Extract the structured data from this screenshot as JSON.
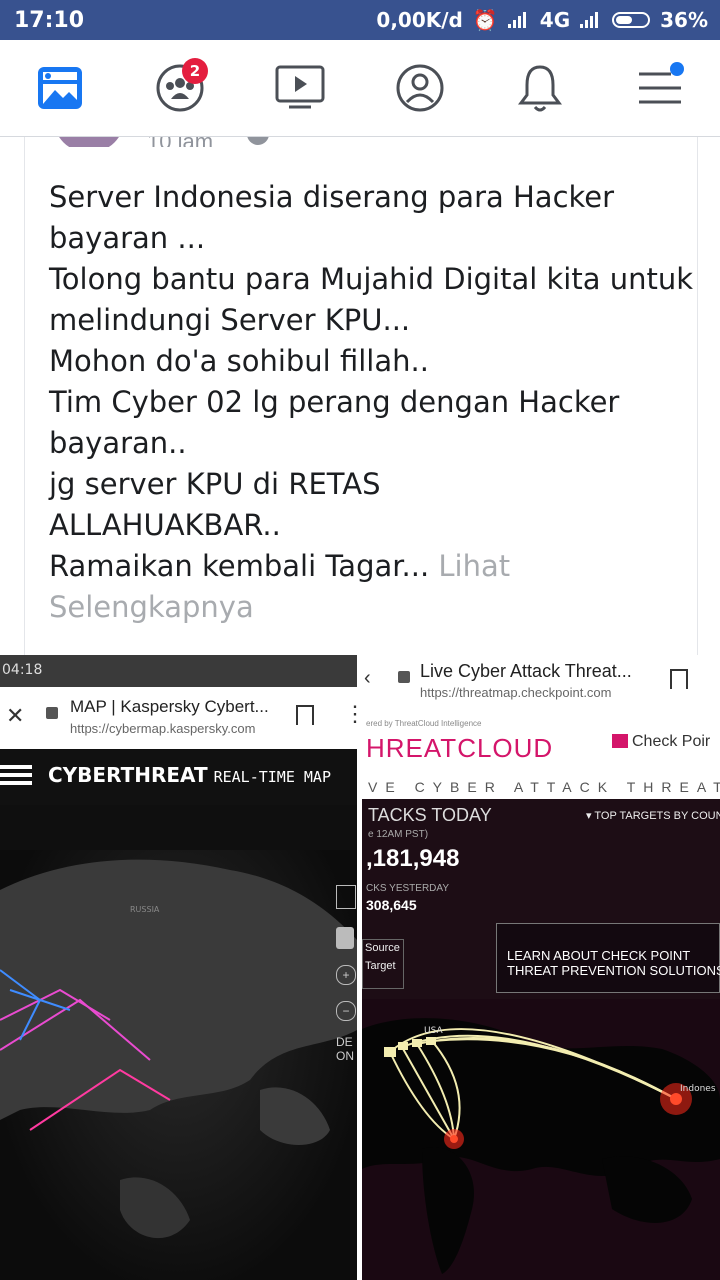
{
  "status_bar": {
    "time": "17:10",
    "network_speed": "0,00K/d",
    "network_type": "4G",
    "battery": "36%"
  },
  "nav": {
    "items": [
      {
        "name": "news-feed",
        "icon": "news-feed-icon"
      },
      {
        "name": "groups",
        "icon": "groups-icon",
        "badge": "2"
      },
      {
        "name": "watch",
        "icon": "video-icon"
      },
      {
        "name": "profile",
        "icon": "profile-icon"
      },
      {
        "name": "notifications",
        "icon": "bell-icon"
      },
      {
        "name": "menu",
        "icon": "menu-icon"
      }
    ],
    "accent": "#1877f2",
    "badge_color": "#e41e3f"
  },
  "post": {
    "time_partial": "10 jam",
    "lines": [
      "Server Indonesia diserang para Hacker",
      "bayaran ...",
      "Tolong bantu para Mujahid Digital kita untuk",
      "melindungi Server KPU...",
      "Mohon do'a sohibul fillah..",
      "Tim Cyber 02 lg perang dengan Hacker",
      "bayaran..",
      "jg server KPU di RETAS",
      "ALLAHUAKBAR..",
      "Ramaikan kembali Tagar..."
    ],
    "see_more_1": "Lihat",
    "see_more_2": "Selengkapnya"
  },
  "photo_left": {
    "status_time": "04:18",
    "page_title": "MAP | Kaspersky Cybert...",
    "url": "https://cybermap.kaspersky.com",
    "brand": "CYBERTHREAT",
    "brand_sub": "REAL-TIME MAP",
    "side_labels": [
      "DE",
      "ON"
    ],
    "map_label": "RUSSIA"
  },
  "photo_right": {
    "page_title": "Live Cyber Attack Threat...",
    "url": "https://threatmap.checkpoint.com",
    "powered": "ered by ThreatCloud Intelligence",
    "logo": "HREATCLOUD",
    "checkpoint": "Check Poir",
    "subtitle": "VE CYBER ATTACK THREAT M",
    "attacks_today_label": "TACKS TODAY",
    "since": "e 12AM PST)",
    "attacks_today": ",181,948",
    "attacks_yesterday_label": "CKS YESTERDAY",
    "attacks_yesterday": "308,645",
    "top_targets": "TOP TARGETS BY COUN",
    "source": "Source",
    "target": "Target",
    "learn_1": "LEARN ABOUT CHECK POINT",
    "learn_2": "THREAT PREVENTION SOLUTIONS",
    "map_label_usa": "USA",
    "map_label_indonesia": "Indones"
  }
}
